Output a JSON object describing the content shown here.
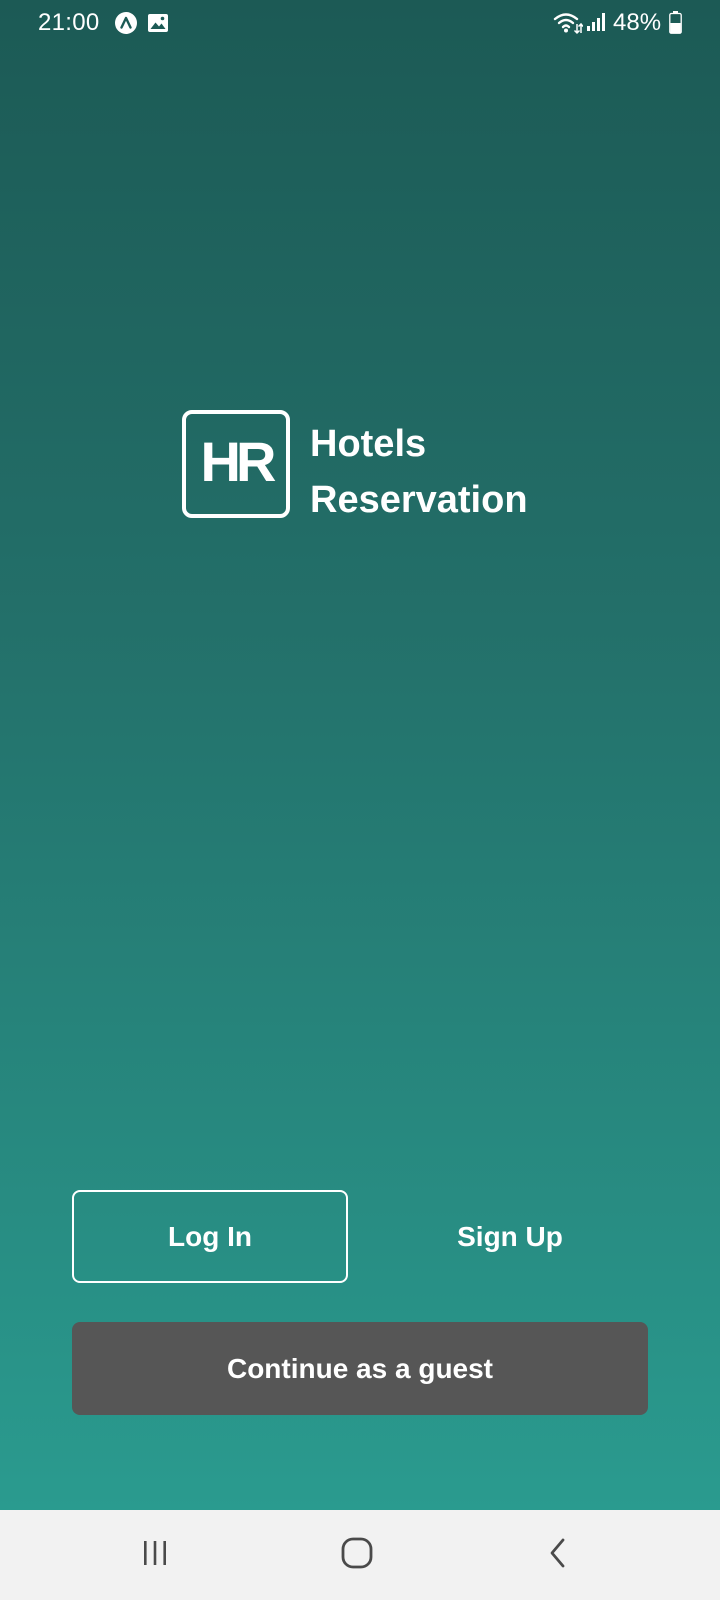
{
  "status_bar": {
    "time": "21:00",
    "battery": "48%",
    "icons": [
      "app-notification-icon",
      "gallery-icon",
      "wifi-icon",
      "signal-icon",
      "battery-icon"
    ]
  },
  "app": {
    "logo_mark": "HR",
    "name_line1": "Hotels",
    "name_line2": "Reservation"
  },
  "actions": {
    "login_label": "Log In",
    "signup_label": "Sign Up",
    "guest_label": "Continue as a guest"
  },
  "nav_bar": {
    "icons": [
      "recent-apps-icon",
      "home-icon",
      "back-icon"
    ]
  },
  "colors": {
    "gradient_top": "#1c5a55",
    "gradient_bottom": "#2a9b8f",
    "guest_button": "#565656",
    "nav_bar_bg": "#f2f2f2",
    "text": "#ffffff"
  }
}
